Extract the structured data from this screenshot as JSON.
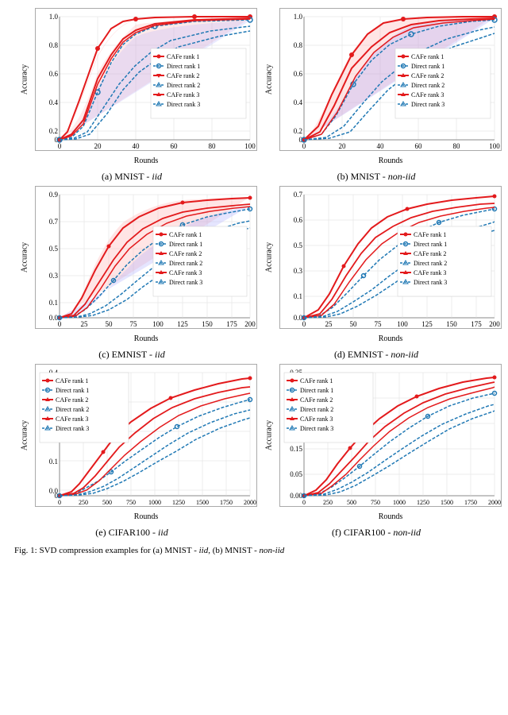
{
  "charts": [
    {
      "id": "a",
      "caption_label": "(a) MNIST - ",
      "caption_italic": "iid",
      "x_label": "Rounds",
      "y_label": "Accuracy",
      "x_max": 100,
      "y_max": 1.0,
      "type": "mnist_iid"
    },
    {
      "id": "b",
      "caption_label": "(b) MNIST - ",
      "caption_italic": "non-iid",
      "x_label": "Rounds",
      "y_label": "Accuracy",
      "x_max": 100,
      "y_max": 1.0,
      "type": "mnist_noniid"
    },
    {
      "id": "c",
      "caption_label": "(c) EMNIST - ",
      "caption_italic": "iid",
      "x_label": "Rounds",
      "y_label": "Accuracy",
      "x_max": 200,
      "y_max": 0.9,
      "type": "emnist_iid"
    },
    {
      "id": "d",
      "caption_label": "(d) EMNIST - ",
      "caption_italic": "non-iid",
      "x_label": "Rounds",
      "y_label": "Accuracy",
      "x_max": 200,
      "y_max": 0.7,
      "type": "emnist_noniid"
    },
    {
      "id": "e",
      "caption_label": "(e) CIFAR100 - ",
      "caption_italic": "iid",
      "x_label": "Rounds",
      "y_label": "Accuracy",
      "x_max": 2000,
      "y_max": 0.45,
      "type": "cifar_iid"
    },
    {
      "id": "f",
      "caption_label": "(f) CIFAR100 - ",
      "caption_italic": "non-iid",
      "x_label": "Rounds",
      "y_label": "Accuracy",
      "x_max": 2000,
      "y_max": 0.35,
      "type": "cifar_noniid"
    }
  ],
  "legend": {
    "items": [
      {
        "label": "CAFe rank 1",
        "color": "#e31a1c",
        "marker": "●",
        "dash": "solid"
      },
      {
        "label": "Direct rank 1",
        "color": "#1f78b4",
        "marker": "●",
        "dash": "dashed"
      },
      {
        "label": "CAFe rank 2",
        "color": "#e31a1c",
        "marker": "▼",
        "dash": "solid"
      },
      {
        "label": "Direct rank 2",
        "color": "#1f78b4",
        "marker": "▽",
        "dash": "dashed"
      },
      {
        "label": "CAFe rank 3",
        "color": "#e31a1c",
        "marker": "▲",
        "dash": "solid"
      },
      {
        "label": "Direct rank 3",
        "color": "#1f78b4",
        "marker": "△",
        "dash": "dashed"
      }
    ]
  },
  "fig_caption": "Fig. 1: SVD compression examples for (a) MNIST - iid, (b) MNIST - non-iid"
}
